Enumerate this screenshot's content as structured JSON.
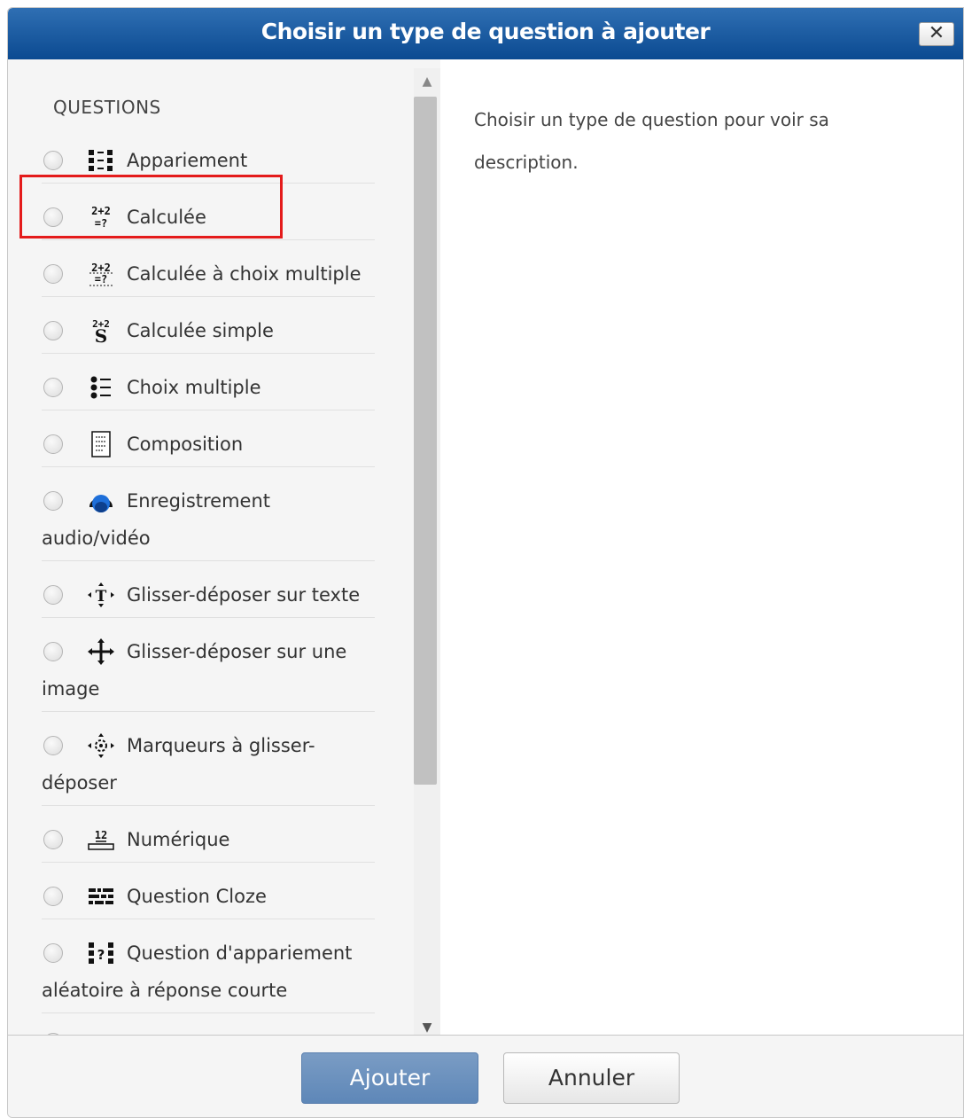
{
  "dialog": {
    "title": "Choisir un type de question à ajouter",
    "close_label": "✕"
  },
  "sidebar": {
    "header": "QUESTIONS",
    "items": [
      {
        "label": "Appariement",
        "label2": "",
        "icon": "match-icon"
      },
      {
        "label": "Calculée",
        "label2": "",
        "icon": "calculated-icon"
      },
      {
        "label": "Calculée à choix multiple",
        "label2": "",
        "icon": "calculated-multichoice-icon"
      },
      {
        "label": "Calculée simple",
        "label2": "",
        "icon": "calculated-simple-icon"
      },
      {
        "label": "Choix multiple",
        "label2": "",
        "icon": "multichoice-icon"
      },
      {
        "label": "Composition",
        "label2": "",
        "icon": "essay-icon"
      },
      {
        "label": "Enregistrement",
        "label2": "audio/vidéo",
        "icon": "recording-icon"
      },
      {
        "label": "Glisser-déposer sur texte",
        "label2": "",
        "icon": "drag-text-icon"
      },
      {
        "label": "Glisser-déposer sur une",
        "label2": "image",
        "icon": "drag-image-icon"
      },
      {
        "label": "Marqueurs à glisser-",
        "label2": "déposer",
        "icon": "drag-markers-icon"
      },
      {
        "label": "Numérique",
        "label2": "",
        "icon": "numerical-icon"
      },
      {
        "label": "Question Cloze",
        "label2": "",
        "icon": "cloze-icon"
      },
      {
        "label": "Question d'appariement",
        "label2": "aléatoire à réponse courte",
        "icon": "random-match-icon"
      }
    ]
  },
  "main": {
    "description": "Choisir un type de question pour voir sa description."
  },
  "footer": {
    "add_label": "Ajouter",
    "cancel_label": "Annuler"
  },
  "colors": {
    "titlebar": "#0b4a91",
    "highlight": "#e41b1b",
    "primary_button": "#6a8fbe"
  }
}
